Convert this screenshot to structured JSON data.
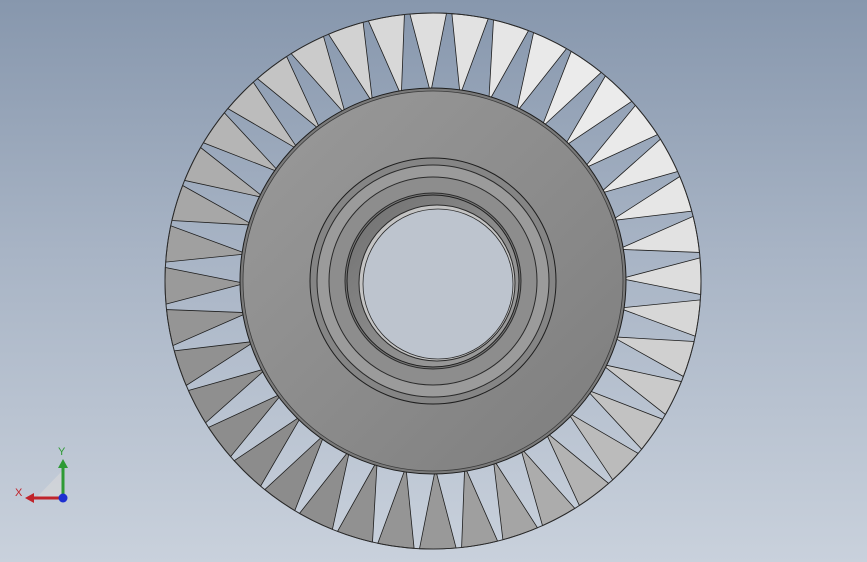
{
  "view": {
    "background_top": "#8797ad",
    "background_bottom": "#c9d1dc"
  },
  "model": {
    "blade_count": 40,
    "blade_color": "#b9b9b9",
    "hub_color": "#8f8f8f",
    "edge_color": "#1e1e1e"
  },
  "triad": {
    "x_label": "X",
    "y_label": "Y",
    "x_color": "#c0242b",
    "y_color": "#2e9a35",
    "z_color": "#1d2fd1"
  }
}
